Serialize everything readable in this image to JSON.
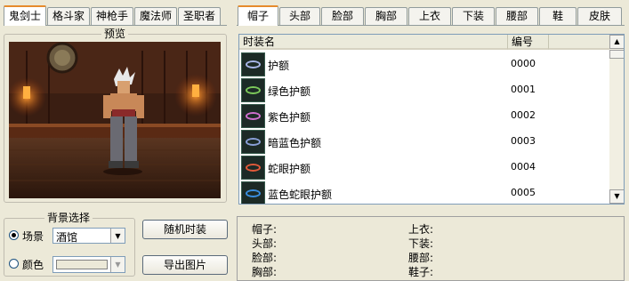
{
  "class_tabs": [
    "鬼剑士",
    "格斗家",
    "神枪手",
    "魔法师",
    "圣职者"
  ],
  "slot_tabs": [
    "帽子",
    "头部",
    "脸部",
    "胸部",
    "上衣",
    "下装",
    "腰部",
    "鞋",
    "皮肤"
  ],
  "active_class_tab": 0,
  "active_slot_tab": 0,
  "preview": {
    "title": "预览"
  },
  "list": {
    "headers": [
      "时装名",
      "编号"
    ],
    "rows": [
      {
        "name": "护额",
        "code": "0000",
        "icon": "purple-headband-icon",
        "color": "#a8b6e8"
      },
      {
        "name": "绿色护额",
        "code": "0001",
        "icon": "green-headband-icon",
        "color": "#7cc85a"
      },
      {
        "name": "紫色护额",
        "code": "0002",
        "icon": "violet-headband-icon",
        "color": "#d070d0"
      },
      {
        "name": "暗蓝色护额",
        "code": "0003",
        "icon": "darkblue-headband-icon",
        "color": "#8aa0d8"
      },
      {
        "name": "蛇眼护额",
        "code": "0004",
        "icon": "red-snakeeye-headband-icon",
        "color": "#e05a3a"
      },
      {
        "name": "蓝色蛇眼护额",
        "code": "0005",
        "icon": "blue-snakeeye-headband-icon",
        "color": "#3a8ee0"
      }
    ]
  },
  "background": {
    "title": "背景选择",
    "scene_label": "场景",
    "scene_value": "酒馆",
    "color_label": "颜色"
  },
  "buttons": {
    "random": "随机时装",
    "export": "导出图片"
  },
  "summary": {
    "left": [
      "帽子:",
      "头部:",
      "脸部:",
      "胸部:"
    ],
    "right": [
      "上衣:",
      "下装:",
      "腰部:",
      "鞋子:"
    ]
  },
  "colors": {
    "active_tab_accent": "#e68b2c",
    "list_border": "#7f9db9"
  }
}
